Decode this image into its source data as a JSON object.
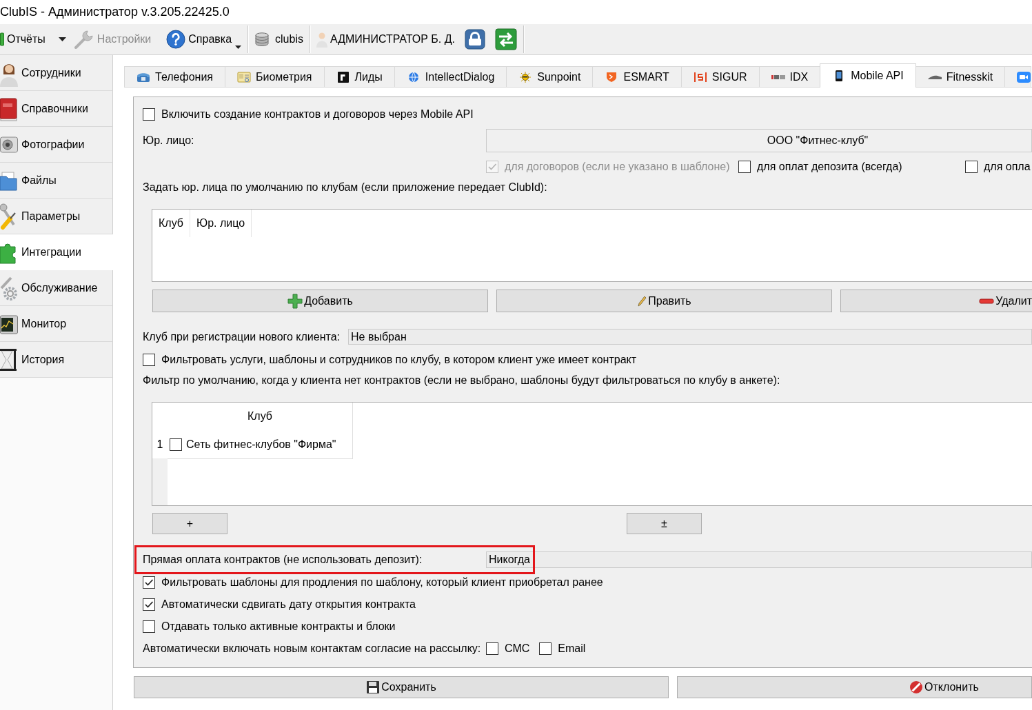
{
  "window": {
    "title": "ClubIS - Администратор v.3.205.22425.0"
  },
  "toolbar": [
    {
      "items": [
        {
          "kind": "split",
          "label": "Отчёты",
          "disabled": false
        },
        {
          "kind": "button",
          "label": "Настройки",
          "disabled": true
        },
        {
          "kind": "menu",
          "label": "Справка",
          "disabled": false
        }
      ]
    },
    {
      "items": [
        {
          "kind": "button",
          "label": "clubis",
          "disabled": false
        }
      ]
    },
    {
      "items": [
        {
          "kind": "button",
          "label": "АДМИНИСТРАТОР Б. Д.",
          "disabled": false
        },
        {
          "kind": "icon",
          "disabled": false
        },
        {
          "kind": "icon",
          "disabled": false
        }
      ]
    }
  ],
  "sidebar": {
    "items": [
      {
        "label": "Сотрудники",
        "selected": false
      },
      {
        "label": "Справочники",
        "selected": false
      },
      {
        "label": "Фотографии",
        "selected": false
      },
      {
        "label": "Файлы",
        "selected": false
      },
      {
        "label": "Параметры",
        "selected": false
      },
      {
        "label": "Интеграции",
        "selected": true
      },
      {
        "label": "Обслуживание",
        "selected": false
      },
      {
        "label": "Монитор",
        "selected": false
      },
      {
        "label": "История",
        "selected": false
      }
    ]
  },
  "tabs": [
    {
      "label": "Телефония",
      "selected": false
    },
    {
      "label": "Биометрия",
      "selected": false
    },
    {
      "label": "Лиды",
      "selected": false
    },
    {
      "label": "IntellectDialog",
      "selected": false
    },
    {
      "label": "Sunpoint",
      "selected": false
    },
    {
      "label": "ESMART",
      "selected": false
    },
    {
      "label": "SIGUR",
      "selected": false
    },
    {
      "label": "IDX",
      "selected": false
    },
    {
      "label": "Mobile API",
      "selected": true
    },
    {
      "label": "Fitnesskit",
      "selected": false
    },
    {
      "selected": false
    }
  ],
  "panel": {
    "enable_contracts": {
      "label": "Включить создание контрактов и договоров через Mobile API",
      "checked": false
    },
    "legal_entity": {
      "label": "Юр. лицо:",
      "value": "ООО \"Фитнес-клуб\""
    },
    "legal_entity_scope": [
      {
        "label": "для договоров (если не указано в шаблоне)",
        "checked": true,
        "disabled": true
      },
      {
        "label": "для оплат депозита (всегда)",
        "checked": false,
        "disabled": false
      },
      {
        "label": "для опла",
        "checked": false,
        "disabled": false
      }
    ],
    "club_entities": {
      "caption": "Задать юр. лица по умолчанию по клубам (если приложение передает ClubId):",
      "columns": [
        "Клуб",
        "Юр. лицо"
      ],
      "buttons": [
        "Добавить",
        "Править",
        "Удалит"
      ]
    },
    "registration_club": {
      "label": "Клуб при регистрации нового клиента:",
      "value": "Не выбран"
    },
    "filter_by_club": {
      "label": "Фильтровать услуги, шаблоны и сотрудников по клубу, в котором клиент уже имеет контракт",
      "checked": false
    },
    "default_filter": {
      "caption": "Фильтр по умолчанию, когда у клиента нет контрактов (если не выбрано, шаблоны будут фильтроваться по клубу в анкете):",
      "columns": [
        "Клуб"
      ],
      "rows": [
        {
          "number": "1",
          "checked": false,
          "club": "Сеть фитнес-клубов \"Фирма\""
        }
      ],
      "buttons": [
        "+",
        "±"
      ]
    },
    "direct_payment": {
      "label": "Прямая оплата контрактов (не использовать депозит):",
      "value": "Никогда",
      "highlighted": true
    },
    "options": [
      {
        "label": "Фильтровать шаблоны для продления по шаблону, который клиент приобретал ранее",
        "checked": true
      },
      {
        "label": "Автоматически сдвигать дату открытия контракта",
        "checked": true
      },
      {
        "label": "Отдавать только активные контракты и блоки",
        "checked": false
      }
    ],
    "mailing_consent": {
      "label": "Автоматически включать новым контактам согласие на рассылку:",
      "channels": [
        {
          "label": "СМС",
          "checked": false
        },
        {
          "label": "Email",
          "checked": false
        }
      ]
    }
  },
  "footer": {
    "buttons": [
      "Сохранить",
      "Отклонить"
    ]
  }
}
